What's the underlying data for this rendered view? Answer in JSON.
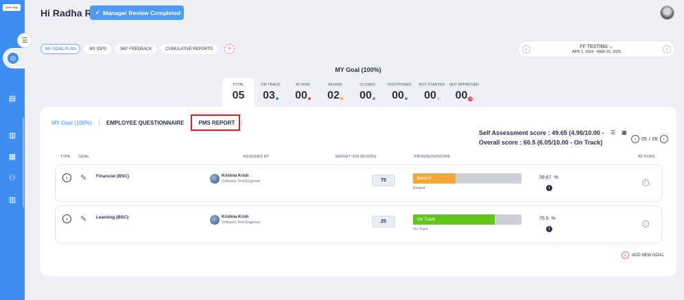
{
  "brand": {
    "logo_text": "your logo"
  },
  "header": {
    "greeting": "Hi Radha R",
    "manager_review_label": "Manager Review Completed"
  },
  "tabs": [
    {
      "label": "MY GOAL PLAN",
      "active": true
    },
    {
      "label": "MY IDPS",
      "active": false
    },
    {
      "label": "360° FEEDBACK",
      "active": false
    },
    {
      "label": "CUMULATIVE REPORTS",
      "active": false
    }
  ],
  "period": {
    "name": "FF TESTING",
    "dates": "APR 1, 2024 - MAR 31, 2025"
  },
  "goal_title": "MY Goal (100%)",
  "stats": [
    {
      "label": "TOTAL",
      "value": "05",
      "dot": ""
    },
    {
      "label": "ON TRACK",
      "value": "03",
      "dot": "#2db36b"
    },
    {
      "label": "AT RISK",
      "value": "00",
      "dot": "#e04a4a"
    },
    {
      "label": "BEHIND",
      "value": "02",
      "dot": "#f4a83a"
    },
    {
      "label": "CLOSED",
      "value": "00",
      "dot": "#8a8f9c"
    },
    {
      "label": "POSTPONED",
      "value": "00",
      "dot": "#5b8fd6"
    },
    {
      "label": "NOT STARTED",
      "value": "00",
      "dot": "#c7cbd4"
    },
    {
      "label": "NOT APPROVED",
      "value": "00",
      "dot": "x"
    }
  ],
  "subtabs": {
    "my_goal": "MY Goal (100%)",
    "employee_questionnaire": "EMPLOYEE QUESTIONNAIRE",
    "pms_report": "PMS REPORT"
  },
  "scores": {
    "self_assessment": "Self Assessment score : 49.65 (4.96/10.00 -",
    "overall": "Overall score : 60.5 (6.05/10.00 - On Track)"
  },
  "pager": {
    "current": "05",
    "sep": "/",
    "total": "05"
  },
  "table": {
    "headers": {
      "type": "TYPE",
      "goal": "GOAL",
      "assigned_by": "ASSIGNED BY",
      "weight": "WEIGHT (100.00/100%)",
      "progress": "PROGRESS/SCORE",
      "actions": "ACTIONS"
    },
    "rows": [
      {
        "goal": "Financial (BSC)",
        "assignee": "Krishna Krish",
        "role": "Software Test Engineer",
        "weight": "75",
        "status": "Behind",
        "status_color": "#f4a83a",
        "progress": 0.39,
        "status_sub": "Behind",
        "score": "39.67",
        "pct_sign": "%"
      },
      {
        "goal": "Learning (BSC)",
        "assignee": "Krishna Krish",
        "role": "Software Test Engineer",
        "weight": "25",
        "status": "On Track",
        "status_color": "#63c71b",
        "progress": 0.755,
        "status_sub": "On Track",
        "score": "75.5",
        "pct_sign": "%"
      }
    ]
  },
  "add_goal_label": "ADD NEW GOAL"
}
